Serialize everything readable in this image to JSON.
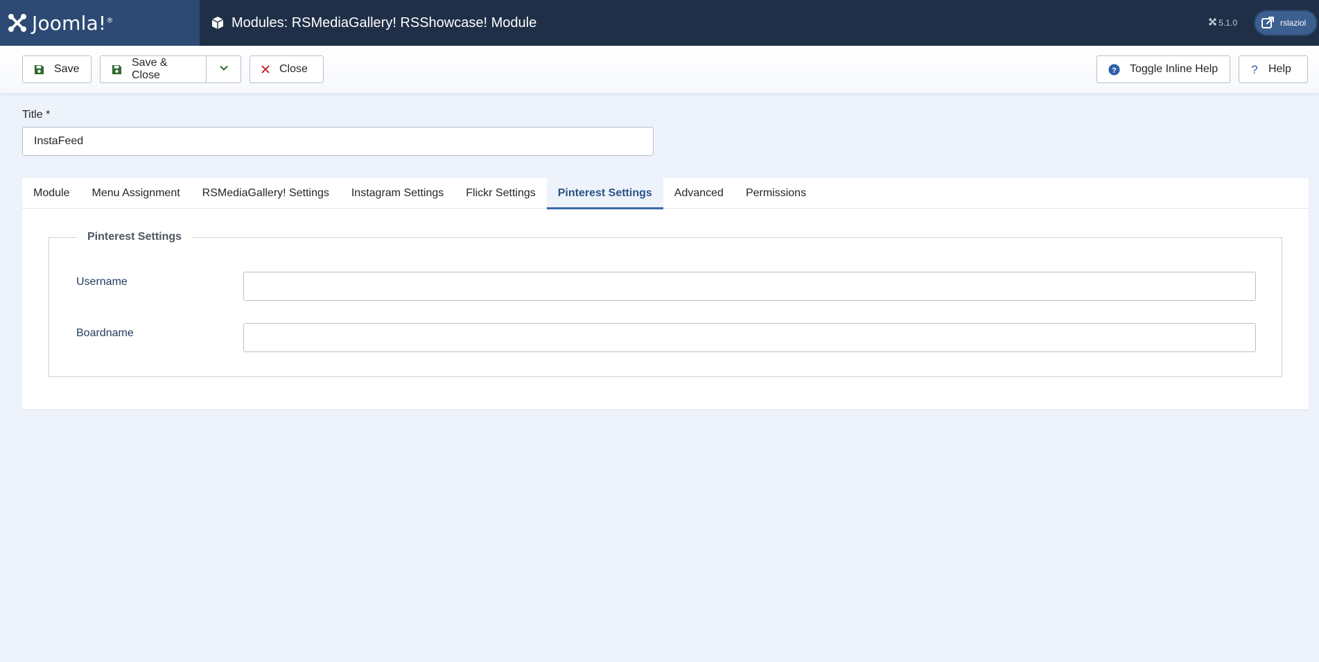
{
  "header": {
    "logo_text": "Joomla!",
    "logo_reg": "®",
    "title": "Modules: RSMediaGallery! RSShowcase! Module",
    "version": "5.1.0",
    "site_name": "rslaziol"
  },
  "toolbar": {
    "save_label": "Save",
    "save_close_label": "Save & Close",
    "close_label": "Close",
    "toggle_help_label": "Toggle Inline Help",
    "help_label": "Help"
  },
  "title_field": {
    "label": "Title *",
    "value": "InstaFeed"
  },
  "tabs": [
    {
      "label": "Module"
    },
    {
      "label": "Menu Assignment"
    },
    {
      "label": "RSMediaGallery! Settings"
    },
    {
      "label": "Instagram Settings"
    },
    {
      "label": "Flickr Settings"
    },
    {
      "label": "Pinterest Settings",
      "active": true
    },
    {
      "label": "Advanced"
    },
    {
      "label": "Permissions"
    }
  ],
  "panel": {
    "legend": "Pinterest Settings",
    "fields": [
      {
        "label": "Username",
        "value": ""
      },
      {
        "label": "Boardname",
        "value": ""
      }
    ]
  },
  "colors": {
    "header_bg": "#1f2f47",
    "logo_bg": "#2c4a73",
    "accent": "#3a6aa8",
    "save_icon": "#2f6b2f",
    "close_icon": "#c0262d",
    "help_icon": "#2a5fa8"
  }
}
